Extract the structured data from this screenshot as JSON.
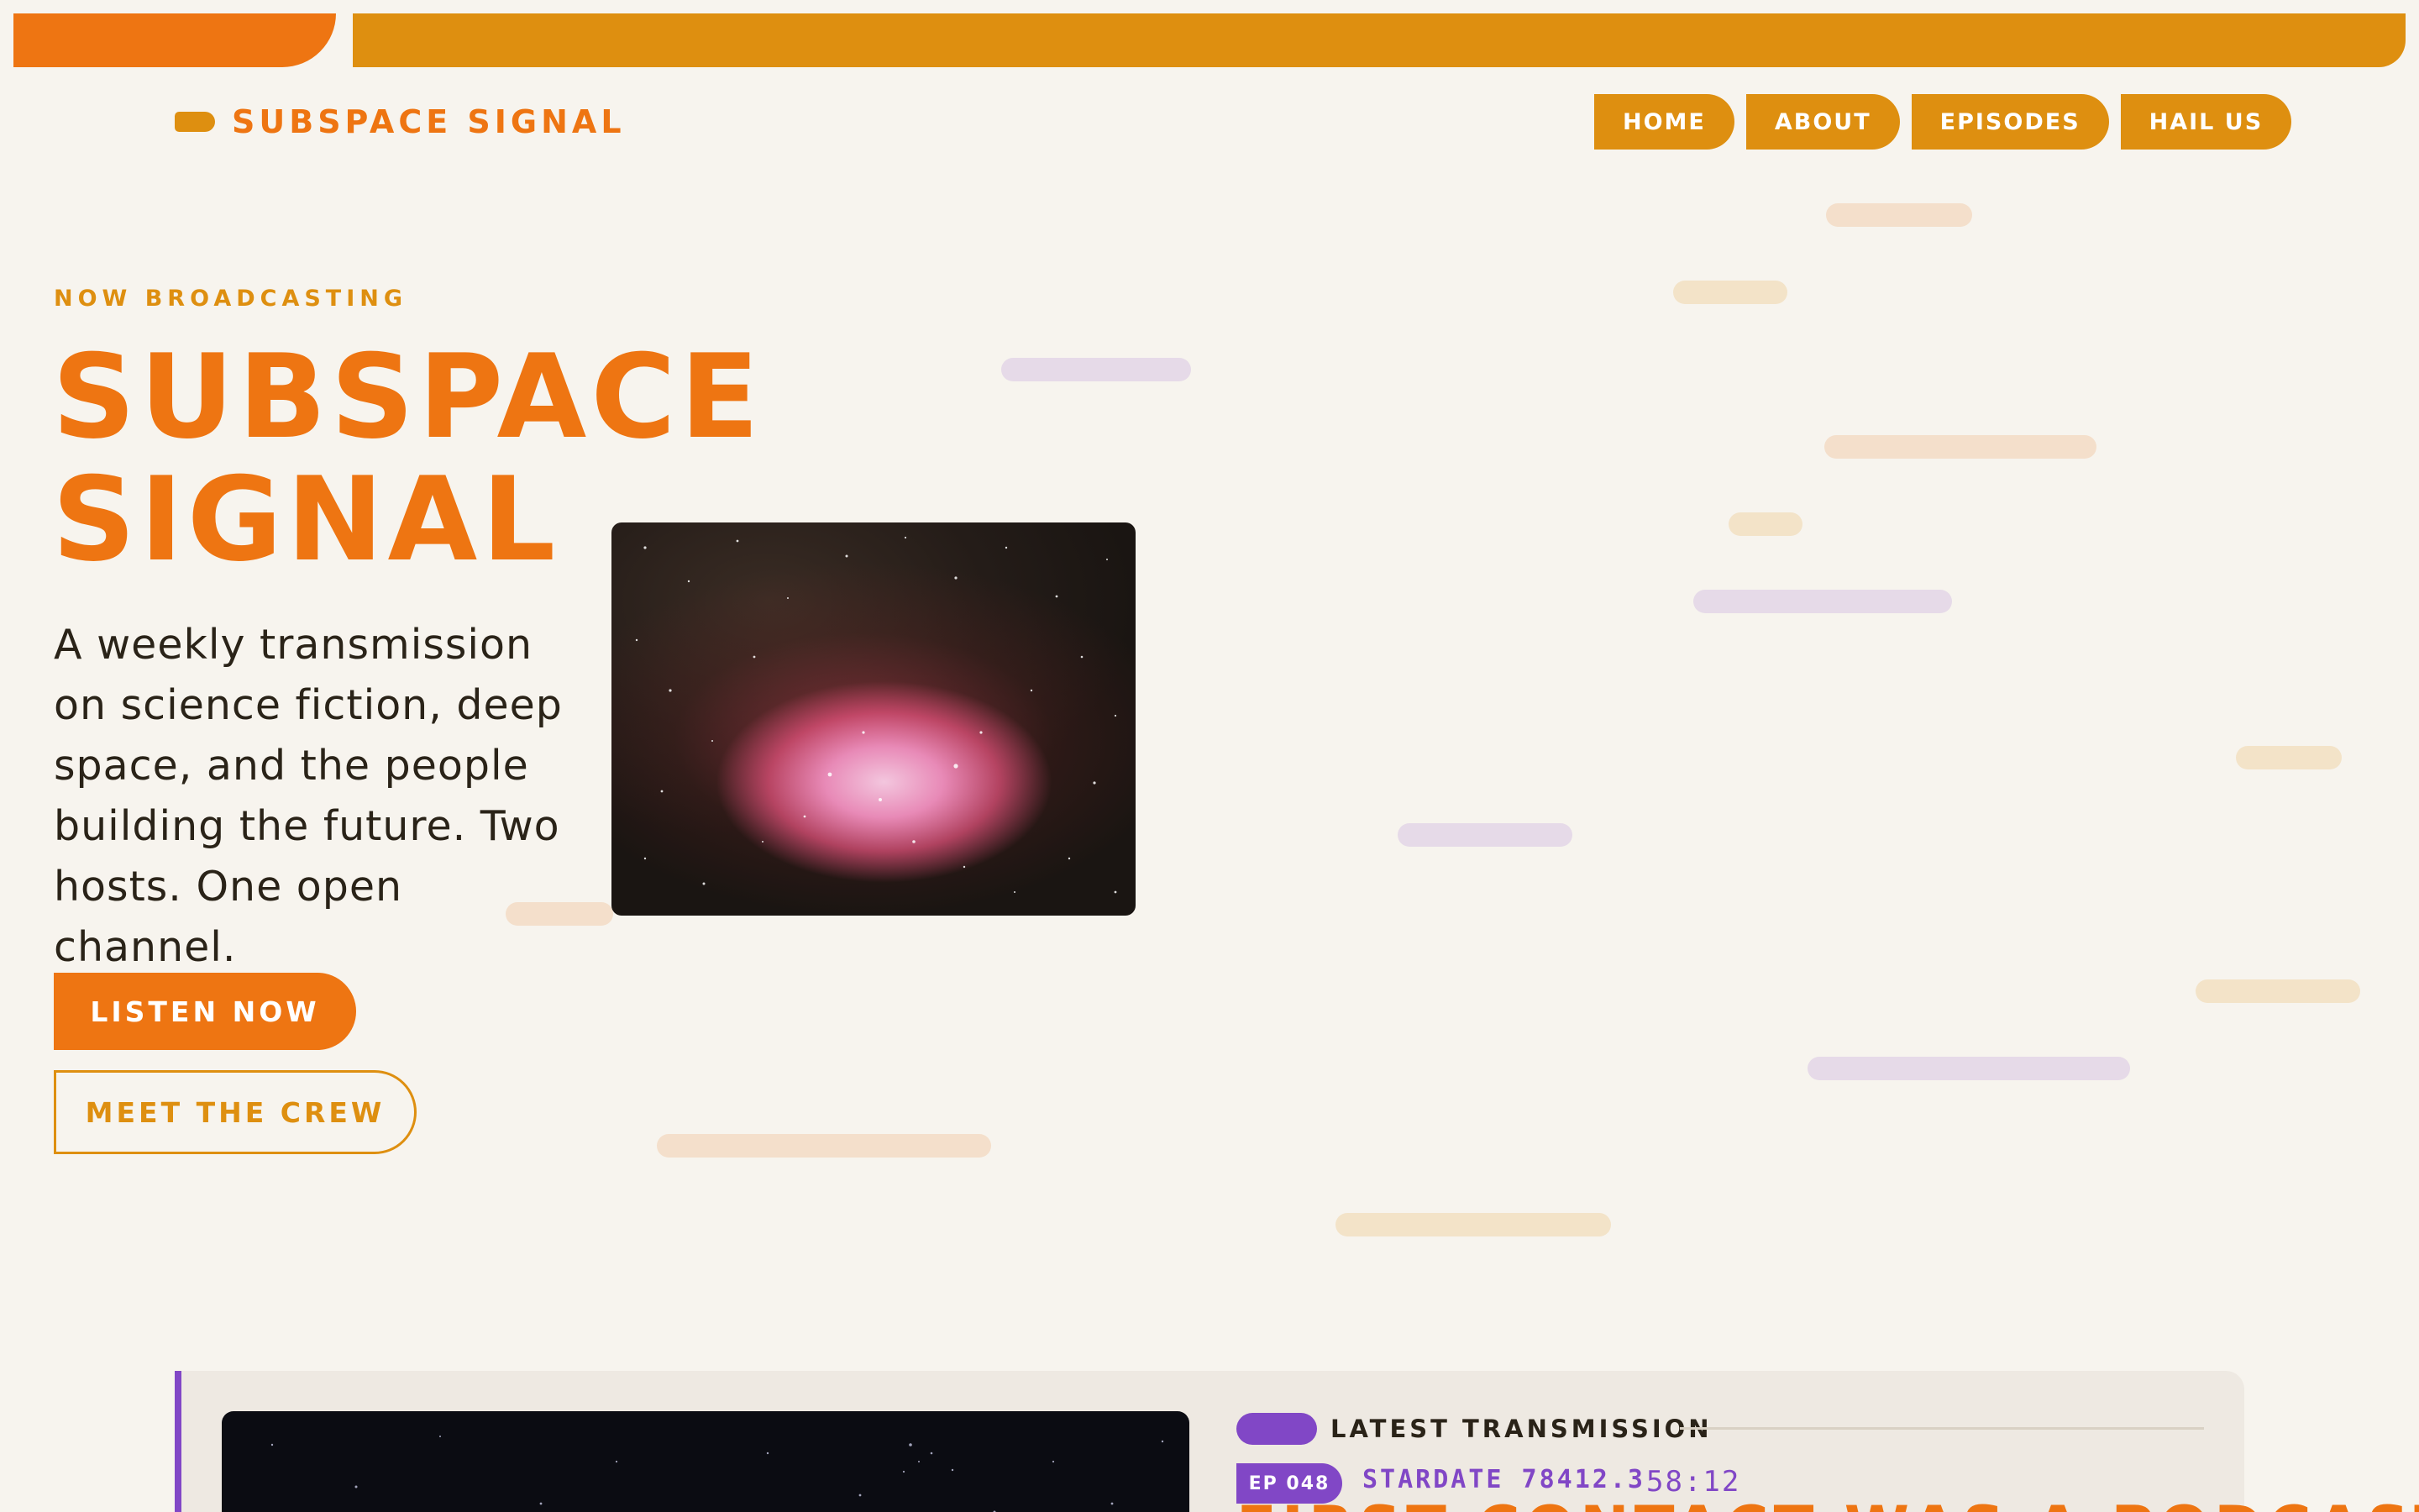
{
  "brand": {
    "name": "SUBSPACE SIGNAL"
  },
  "nav": {
    "items": [
      {
        "label": "HOME"
      },
      {
        "label": "ABOUT"
      },
      {
        "label": "EPISODES"
      },
      {
        "label": "HAIL US"
      }
    ]
  },
  "hero": {
    "eyebrow": "NOW BROADCASTING",
    "title": "SUBSPACE SIGNAL",
    "description": "A weekly transmission on science fiction, deep space, and the people building the future. Two hosts. One open channel.",
    "cta_primary": "LISTEN NOW",
    "cta_secondary": "MEET THE CREW"
  },
  "latest": {
    "label": "LATEST TRANSMISSION",
    "episode_badge": "EP 048",
    "stardate": "STARDATE 78412.3",
    "duration": "58:12",
    "title": "FIRST CONTACT WAS A PODCAST"
  },
  "colors": {
    "orange": "#ee7512",
    "amber": "#de8f10",
    "purple": "#8147c6",
    "background": "#f7f4ee"
  }
}
